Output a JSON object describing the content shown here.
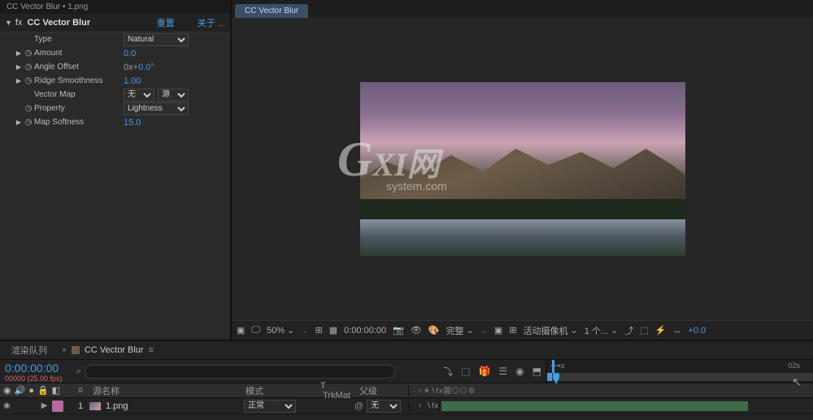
{
  "effect_panel": {
    "tab": "CC Vector Blur • 1.png",
    "effect_name": "CC Vector Blur",
    "reset": "重置",
    "about": "关于 ...",
    "params": {
      "type_label": "Type",
      "type_value": "Natural",
      "amount_label": "Amount",
      "amount_value": "0.0",
      "angle_label": "Angle Offset",
      "angle_prefix": "0x",
      "angle_value": "+0.0°",
      "ridge_label": "Ridge Smoothness",
      "ridge_value": "1.00",
      "vmap_label": "Vector Map",
      "vmap_value": "无",
      "vmap_source": "源",
      "prop_label": "Property",
      "prop_value": "Lightness",
      "soft_label": "Map Softness",
      "soft_value": "15.0"
    }
  },
  "preview": {
    "tab": "CC Vector Blur",
    "watermark_big": "G",
    "watermark_text": "XI网",
    "watermark_small": "system.com",
    "toolbar": {
      "zoom": "50%",
      "time": "0:00:00:00",
      "quality": "完整",
      "camera": "活动摄像机",
      "views": "1 个...",
      "exposure": "+0.0"
    }
  },
  "timeline": {
    "queue_tab": "渲染队列",
    "comp_tab": "CC Vector Blur",
    "cur_time": "0:00:00:00",
    "fps": "00000 (25.00 fps)",
    "search_placeholder": "",
    "ruler_end": "02s",
    "columns": {
      "num": "#",
      "source": "源名称",
      "mode": "模式",
      "trkmat": "TrkMat",
      "parent": "父级",
      "switches": "♀☀∖fx圓◎◎⊕"
    },
    "layer": {
      "index": "1",
      "name": "1.png",
      "mode": "正常",
      "parent": "无",
      "switches": "♀  ∖fx"
    }
  }
}
